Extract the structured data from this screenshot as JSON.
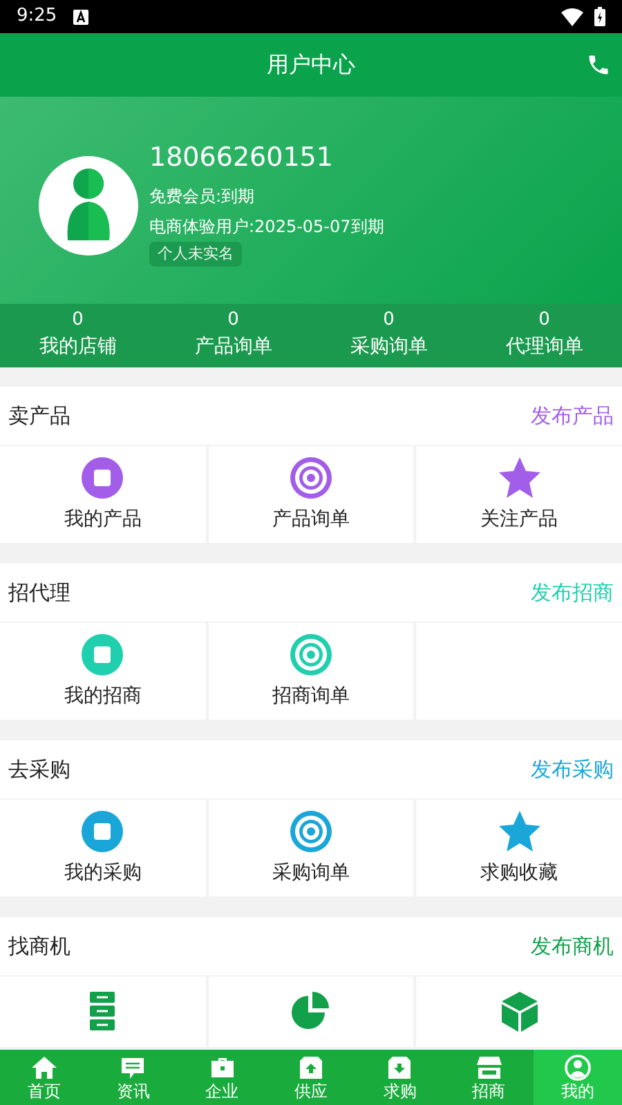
{
  "status_bar": {
    "time": "9:25"
  },
  "header": {
    "title": "用户中心"
  },
  "profile": {
    "phone": "18066260151",
    "membership": "免费会员:到期",
    "trial": "电商体验用户:2025-05-07到期",
    "badge": "个人未实名"
  },
  "stats": [
    {
      "value": "0",
      "label": "我的店铺"
    },
    {
      "value": "0",
      "label": "产品询单"
    },
    {
      "value": "0",
      "label": "采购询单"
    },
    {
      "value": "0",
      "label": "代理询单"
    }
  ],
  "sections": [
    {
      "title": "卖产品",
      "action": "发布产品",
      "color": "#a35ee9",
      "items": [
        {
          "kind": "stop",
          "label": "我的产品"
        },
        {
          "kind": "target",
          "label": "产品询单"
        },
        {
          "kind": "star",
          "label": "关注产品"
        }
      ]
    },
    {
      "title": "招代理",
      "action": "发布招商",
      "color": "#1fcfae",
      "items": [
        {
          "kind": "stop",
          "label": "我的招商"
        },
        {
          "kind": "target",
          "label": "招商询单"
        },
        {
          "kind": "empty"
        }
      ]
    },
    {
      "title": "去采购",
      "action": "发布采购",
      "color": "#1aa6d9",
      "items": [
        {
          "kind": "stop",
          "label": "我的采购"
        },
        {
          "kind": "target",
          "label": "采购询单"
        },
        {
          "kind": "star",
          "label": "求购收藏"
        }
      ]
    },
    {
      "title": "找商机",
      "action": "发布商机",
      "color": "#12a04a",
      "items": [
        {
          "kind": "drawers"
        },
        {
          "kind": "pie"
        },
        {
          "kind": "cube"
        }
      ]
    }
  ],
  "bottom_nav": [
    {
      "kind": "home",
      "label": "首页",
      "selected": false
    },
    {
      "kind": "chat",
      "label": "资讯",
      "selected": false
    },
    {
      "kind": "briefcase",
      "label": "企业",
      "selected": false
    },
    {
      "kind": "upload",
      "label": "供应",
      "selected": false
    },
    {
      "kind": "download",
      "label": "求购",
      "selected": false
    },
    {
      "kind": "store",
      "label": "招商",
      "selected": false
    },
    {
      "kind": "user",
      "label": "我的",
      "selected": true
    }
  ]
}
